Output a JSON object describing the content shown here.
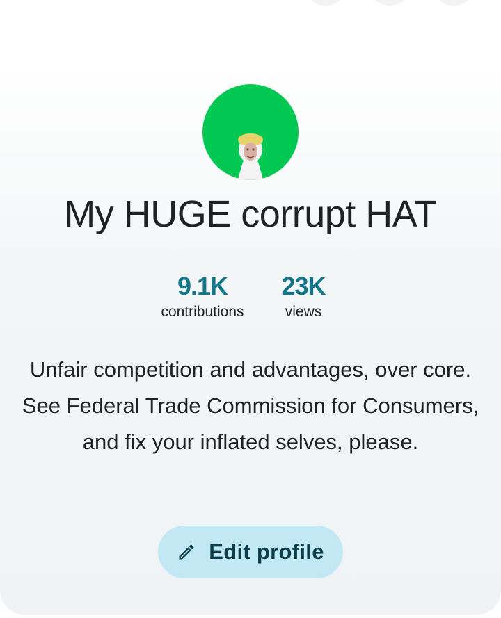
{
  "profile": {
    "name": "My HUGE corrupt HAT",
    "avatar_color": "#00c853",
    "bio": "Unfair competition and advantages, over core. See Federal Trade Commission for Consumers, and fix your inflated selves, please."
  },
  "stats": [
    {
      "value": "9.1K",
      "label": "contributions"
    },
    {
      "value": "23K",
      "label": "views"
    }
  ],
  "actions": {
    "edit_label": "Edit profile",
    "edit_icon": "pencil-icon"
  },
  "colors": {
    "accent": "#137789",
    "button_bg": "#c2e9f3",
    "button_text": "#0b3f4c"
  }
}
